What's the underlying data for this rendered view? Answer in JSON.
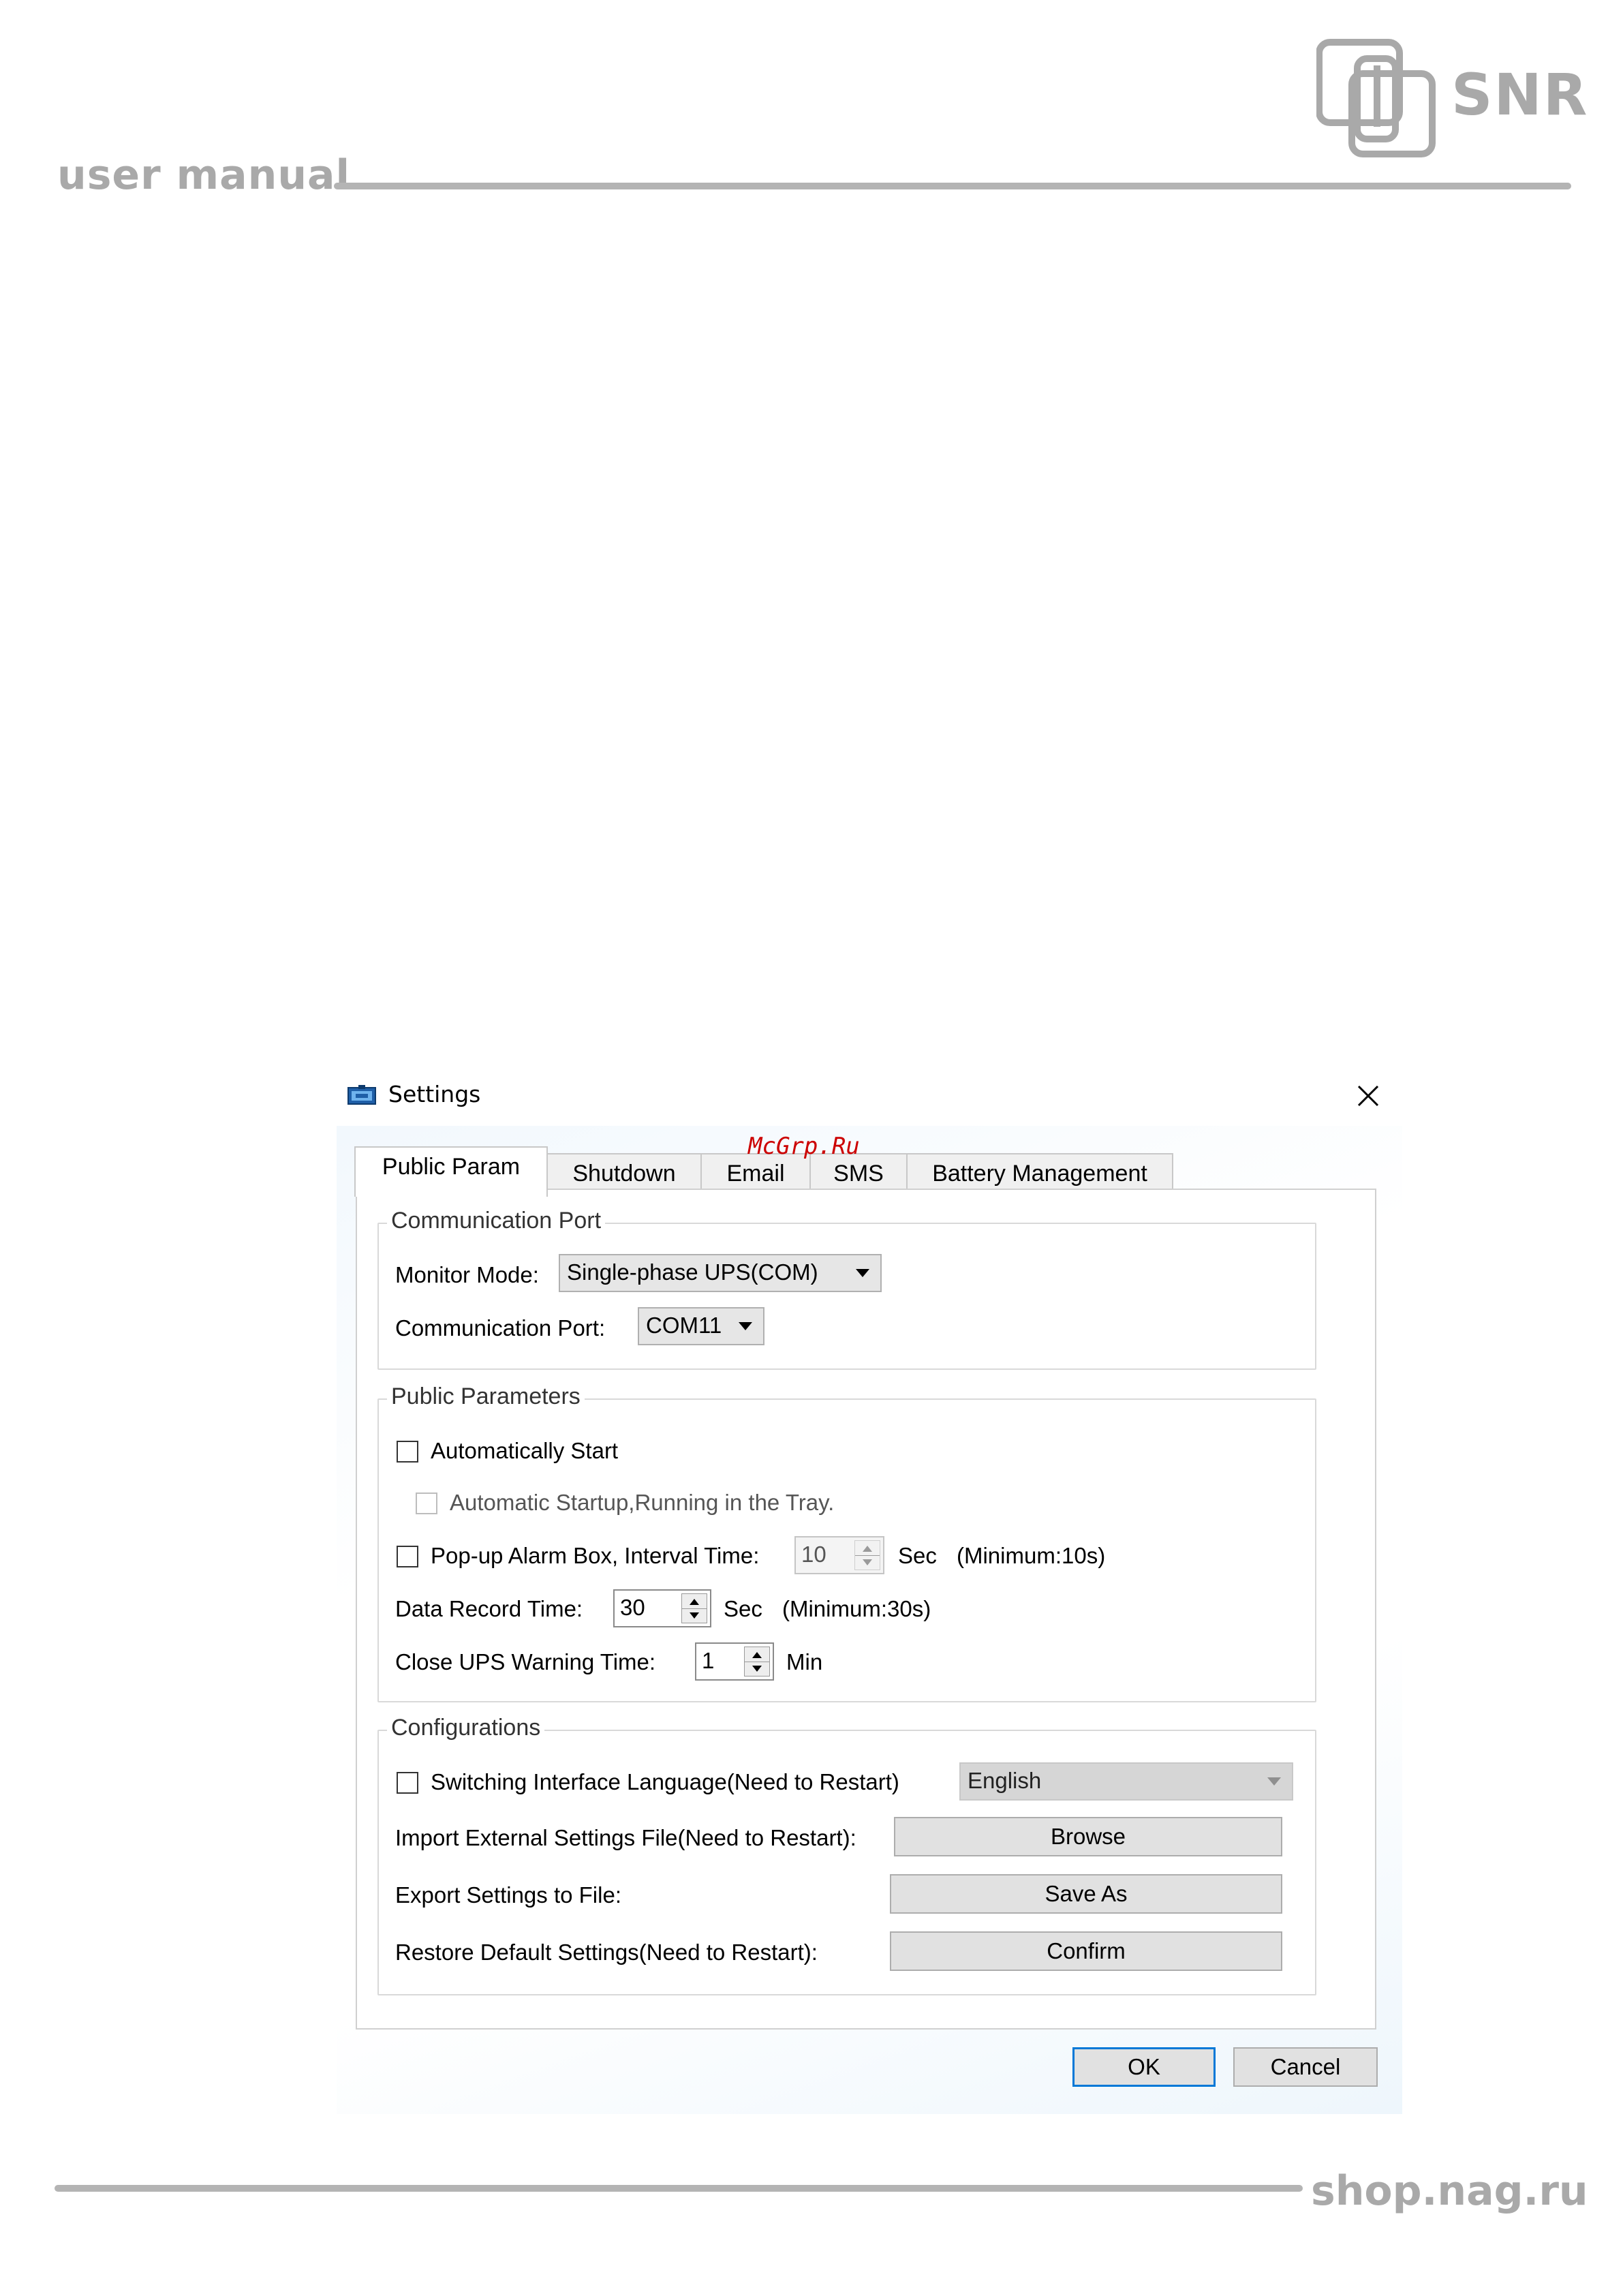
{
  "page": {
    "brand": "SNR",
    "manual_title": "user manual",
    "footer_site": "shop.nag.ru",
    "watermark": "McGrp.Ru"
  },
  "dialog": {
    "title": "Settings",
    "tabs": [
      {
        "label": "Public Param",
        "active": true
      },
      {
        "label": "Shutdown",
        "active": false
      },
      {
        "label": "Email",
        "active": false
      },
      {
        "label": "SMS",
        "active": false
      },
      {
        "label": "Battery Management",
        "active": false
      }
    ],
    "communication_port": {
      "group_title": "Communication Port",
      "monitor_mode_label": "Monitor Mode:",
      "monitor_mode_value": "Single-phase UPS(COM)",
      "port_label": "Communication Port:",
      "port_value": "COM11"
    },
    "public_parameters": {
      "group_title": "Public Parameters",
      "auto_start_label": "Automatically Start",
      "auto_start_checked": false,
      "tray_label": "Automatic Startup,Running in the Tray.",
      "tray_checked": false,
      "popup_label": "Pop-up Alarm Box, Interval Time:",
      "popup_checked": false,
      "popup_interval": "10",
      "popup_unit": "Sec",
      "popup_min": "(Minimum:10s)",
      "data_record_label": "Data Record Time:",
      "data_record_value": "30",
      "data_record_unit": "Sec",
      "data_record_min": "(Minimum:30s)",
      "close_warning_label": "Close UPS Warning Time:",
      "close_warning_value": "1",
      "close_warning_unit": "Min"
    },
    "configurations": {
      "group_title": "Configurations",
      "switch_lang_label": "Switching Interface Language(Need to Restart)",
      "switch_lang_checked": false,
      "language_value": "English",
      "import_label": "Import External Settings File(Need to Restart):",
      "import_button": "Browse",
      "export_label": "Export Settings to File:",
      "export_button": "Save As",
      "restore_label": "Restore Default Settings(Need to Restart):",
      "restore_button": "Confirm"
    },
    "ok_button": "OK",
    "cancel_button": "Cancel"
  },
  "colors": {
    "accent": "#0078d7",
    "brand_gray": "#a9a9a9",
    "watermark": "#cc0000"
  }
}
